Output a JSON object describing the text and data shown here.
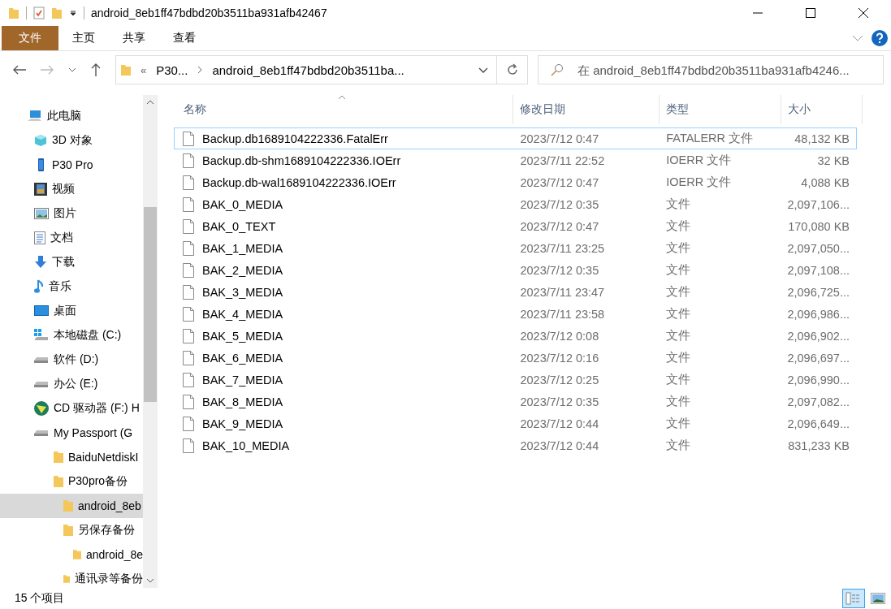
{
  "window": {
    "title": "android_8eb1ff47bdbd20b3511ba931afb42467"
  },
  "ribbon_tabs": [
    {
      "label": "文件",
      "kind": "file"
    },
    {
      "label": "主页",
      "kind": "tab"
    },
    {
      "label": "共享",
      "kind": "tab"
    },
    {
      "label": "查看",
      "kind": "tab"
    }
  ],
  "address_bar": {
    "overflow": "«",
    "crumbs": [
      "P30...",
      "android_8eb1ff47bdbd20b3511ba..."
    ]
  },
  "search": {
    "placeholder": "在 android_8eb1ff47bdbd20b3511ba931afb4246..."
  },
  "sidebar": {
    "items": [
      {
        "label": "此电脑",
        "kind": "pc",
        "selected": false,
        "children": [
          {
            "label": "3D 对象",
            "kind": "cube",
            "selected": false
          },
          {
            "label": "P30 Pro",
            "kind": "phone",
            "selected": false
          },
          {
            "label": "视频",
            "kind": "video",
            "selected": false
          },
          {
            "label": "图片",
            "kind": "picture",
            "selected": false
          },
          {
            "label": "文档",
            "kind": "doc",
            "selected": false
          },
          {
            "label": "下载",
            "kind": "download",
            "selected": false
          },
          {
            "label": "音乐",
            "kind": "music",
            "selected": false
          },
          {
            "label": "桌面",
            "kind": "desktop",
            "selected": false
          },
          {
            "label": "本地磁盘 (C:)",
            "kind": "sysdrive",
            "selected": false
          },
          {
            "label": "软件 (D:)",
            "kind": "drive",
            "selected": false
          },
          {
            "label": "办公 (E:)",
            "kind": "drive",
            "selected": false
          },
          {
            "label": "CD 驱动器 (F:) H",
            "kind": "cd",
            "selected": false
          },
          {
            "label": "My Passport (G",
            "kind": "drive",
            "selected": false,
            "children": [
              {
                "label": "BaiduNetdiskI",
                "kind": "folder",
                "selected": false
              },
              {
                "label": "P30pro备份",
                "kind": "folder",
                "selected": false,
                "children": [
                  {
                    "label": "android_8eb",
                    "kind": "folder",
                    "selected": true
                  },
                  {
                    "label": "另保存备份",
                    "kind": "folder",
                    "selected": false,
                    "children": [
                      {
                        "label": "android_8e",
                        "kind": "folder",
                        "selected": false
                      }
                    ]
                  },
                  {
                    "label": "通讯录等备份",
                    "kind": "folder",
                    "selected": false
                  }
                ]
              }
            ]
          }
        ]
      }
    ]
  },
  "table": {
    "columns": [
      "名称",
      "修改日期",
      "类型",
      "大小"
    ],
    "rows": [
      {
        "name": "Backup.db1689104222336.FatalErr",
        "date": "2023/7/12 0:47",
        "type": "FATALERR 文件",
        "size": "48,132 KB",
        "focused": true
      },
      {
        "name": "Backup.db-shm1689104222336.IOErr",
        "date": "2023/7/11 22:52",
        "type": "IOERR 文件",
        "size": "32 KB",
        "focused": false
      },
      {
        "name": "Backup.db-wal1689104222336.IOErr",
        "date": "2023/7/12 0:47",
        "type": "IOERR 文件",
        "size": "4,088 KB",
        "focused": false
      },
      {
        "name": "BAK_0_MEDIA",
        "date": "2023/7/12 0:35",
        "type": "文件",
        "size": "2,097,106...",
        "focused": false
      },
      {
        "name": "BAK_0_TEXT",
        "date": "2023/7/12 0:47",
        "type": "文件",
        "size": "170,080 KB",
        "focused": false
      },
      {
        "name": "BAK_1_MEDIA",
        "date": "2023/7/11 23:25",
        "type": "文件",
        "size": "2,097,050...",
        "focused": false
      },
      {
        "name": "BAK_2_MEDIA",
        "date": "2023/7/12 0:35",
        "type": "文件",
        "size": "2,097,108...",
        "focused": false
      },
      {
        "name": "BAK_3_MEDIA",
        "date": "2023/7/11 23:47",
        "type": "文件",
        "size": "2,096,725...",
        "focused": false
      },
      {
        "name": "BAK_4_MEDIA",
        "date": "2023/7/11 23:58",
        "type": "文件",
        "size": "2,096,986...",
        "focused": false
      },
      {
        "name": "BAK_5_MEDIA",
        "date": "2023/7/12 0:08",
        "type": "文件",
        "size": "2,096,902...",
        "focused": false
      },
      {
        "name": "BAK_6_MEDIA",
        "date": "2023/7/12 0:16",
        "type": "文件",
        "size": "2,096,697...",
        "focused": false
      },
      {
        "name": "BAK_7_MEDIA",
        "date": "2023/7/12 0:25",
        "type": "文件",
        "size": "2,096,990...",
        "focused": false
      },
      {
        "name": "BAK_8_MEDIA",
        "date": "2023/7/12 0:35",
        "type": "文件",
        "size": "2,097,082...",
        "focused": false
      },
      {
        "name": "BAK_9_MEDIA",
        "date": "2023/7/12 0:44",
        "type": "文件",
        "size": "2,096,649...",
        "focused": false
      },
      {
        "name": "BAK_10_MEDIA",
        "date": "2023/7/12 0:44",
        "type": "文件",
        "size": "831,233 KB",
        "focused": false
      }
    ]
  },
  "status_bar": {
    "count": "15 个项目",
    "views": [
      {
        "kind": "details",
        "selected": true
      },
      {
        "kind": "large",
        "selected": false
      }
    ]
  }
}
